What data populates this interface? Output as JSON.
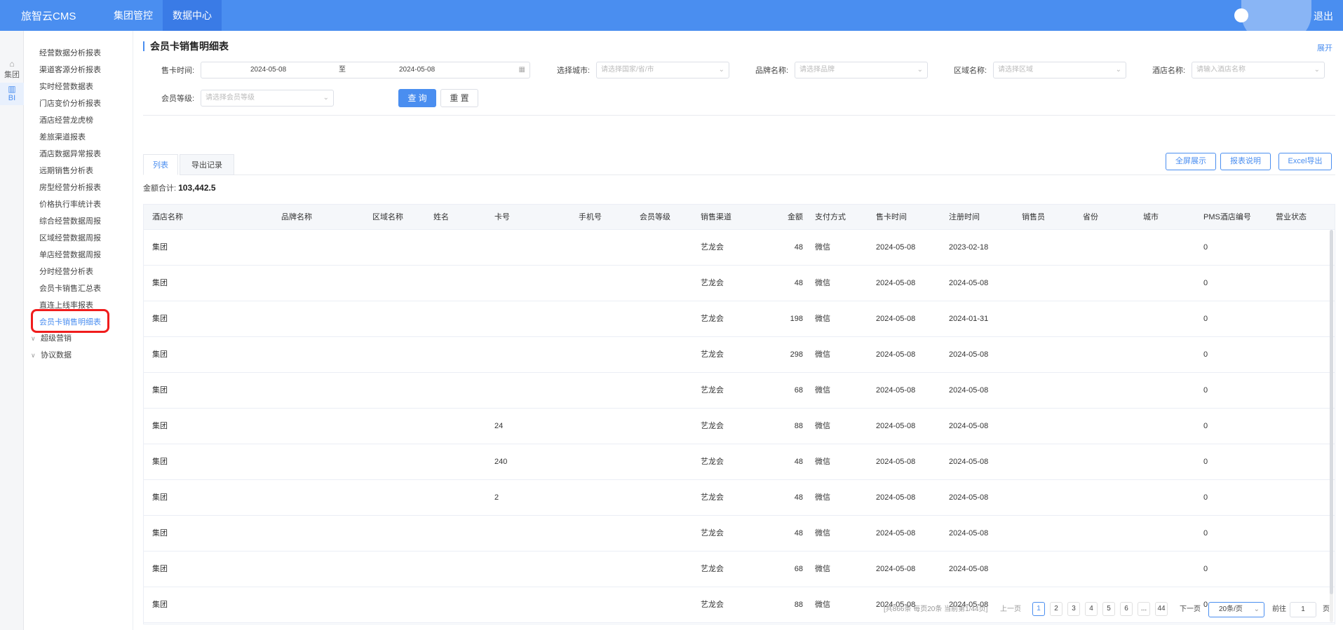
{
  "topbar": {
    "brand": "旅智云CMS",
    "nav": [
      "集团管控",
      "数据中心"
    ],
    "logout": "退出"
  },
  "rail": [
    {
      "icon": "building-icon",
      "label": "集团"
    },
    {
      "icon": "bar-chart-icon",
      "label": "BI"
    }
  ],
  "sidebar": {
    "items": [
      "经营数据分析报表",
      "渠道客源分析报表",
      "实时经营数据表",
      "门店变价分析报表",
      "酒店经营龙虎榜",
      "差旅渠道报表",
      "酒店数据异常报表",
      "远期销售分析表",
      "房型经营分析报表",
      "价格执行率统计表",
      "综合经营数据周报",
      "区域经营数据周报",
      "单店经营数据周报",
      "分时经营分析表",
      "会员卡销售汇总表",
      "直连上线率报表",
      "会员卡销售明细表"
    ],
    "active_index": 16,
    "groups": [
      "超级营销",
      "协议数据"
    ]
  },
  "page": {
    "title": "会员卡销售明细表",
    "expand": "展开"
  },
  "filters": {
    "sale_time_label": "售卡时间:",
    "date_from": "2024-05-08",
    "date_to_sep": "至",
    "date_to": "2024-05-08",
    "city_label": "选择城市:",
    "city_placeholder": "请选择国家/省/市",
    "brand_label": "品牌名称:",
    "brand_placeholder": "请选择品牌",
    "region_label": "区域名称:",
    "region_placeholder": "请选择区域",
    "hotel_label": "酒店名称:",
    "hotel_placeholder": "请输入酒店名称",
    "level_label": "会员等级:",
    "level_placeholder": "请选择会员等级",
    "query": "查 询",
    "reset": "重 置"
  },
  "tabs": [
    "列表",
    "导出记录"
  ],
  "actions": [
    "全屏展示",
    "报表说明",
    "Excel导出"
  ],
  "summary": {
    "label": "金额合计:",
    "value": "103,442.5"
  },
  "table": {
    "headers": [
      "酒店名称",
      "品牌名称",
      "区域名称",
      "姓名",
      "卡号",
      "手机号",
      "会员等级",
      "销售渠道",
      "金额",
      "支付方式",
      "售卡时间",
      "注册时间",
      "销售员",
      "省份",
      "城市",
      "PMS酒店编号",
      "营业状态"
    ],
    "rows": [
      [
        "集团",
        "",
        "",
        "",
        "",
        "",
        "",
        "艺龙会",
        "48",
        "微信",
        "2024-05-08",
        "2023-02-18",
        "",
        "",
        "",
        "0",
        ""
      ],
      [
        "集团",
        "",
        "",
        "",
        "",
        "",
        "",
        "艺龙会",
        "48",
        "微信",
        "2024-05-08",
        "2024-05-08",
        "",
        "",
        "",
        "0",
        ""
      ],
      [
        "集团",
        "",
        "",
        "",
        "",
        "",
        "",
        "艺龙会",
        "198",
        "微信",
        "2024-05-08",
        "2024-01-31",
        "",
        "",
        "",
        "0",
        ""
      ],
      [
        "集团",
        "",
        "",
        "",
        "",
        "",
        "",
        "艺龙会",
        "298",
        "微信",
        "2024-05-08",
        "2024-05-08",
        "",
        "",
        "",
        "0",
        ""
      ],
      [
        "集团",
        "",
        "",
        "",
        "",
        "",
        "",
        "艺龙会",
        "68",
        "微信",
        "2024-05-08",
        "2024-05-08",
        "",
        "",
        "",
        "0",
        ""
      ],
      [
        "集团",
        "",
        "",
        "",
        "24",
        "",
        "",
        "艺龙会",
        "88",
        "微信",
        "2024-05-08",
        "2024-05-08",
        "",
        "",
        "",
        "0",
        ""
      ],
      [
        "集团",
        "",
        "",
        "",
        "240",
        "",
        "",
        "艺龙会",
        "48",
        "微信",
        "2024-05-08",
        "2024-05-08",
        "",
        "",
        "",
        "0",
        ""
      ],
      [
        "集团",
        "",
        "",
        "",
        "2",
        "",
        "",
        "艺龙会",
        "48",
        "微信",
        "2024-05-08",
        "2024-05-08",
        "",
        "",
        "",
        "0",
        ""
      ],
      [
        "集团",
        "",
        "",
        "",
        "",
        "",
        "",
        "艺龙会",
        "48",
        "微信",
        "2024-05-08",
        "2024-05-08",
        "",
        "",
        "",
        "0",
        ""
      ],
      [
        "集团",
        "",
        "",
        "",
        "",
        "",
        "",
        "艺龙会",
        "68",
        "微信",
        "2024-05-08",
        "2024-05-08",
        "",
        "",
        "",
        "0",
        ""
      ],
      [
        "集团",
        "",
        "",
        "",
        "",
        "",
        "",
        "艺龙会",
        "88",
        "微信",
        "2024-05-08",
        "2024-05-08",
        "",
        "",
        "",
        "0",
        ""
      ]
    ]
  },
  "pagination": {
    "info": "[共866条 每页20条 当前第1/44页]",
    "prev": "上一页",
    "pages": [
      "1",
      "2",
      "3",
      "4",
      "5",
      "6",
      "...",
      "44"
    ],
    "next": "下一页",
    "page_size": "20条/页",
    "goto_label": "前往",
    "goto_value": "1",
    "page_suffix": "页"
  },
  "colors": {
    "topbar": "#4a8ef0",
    "accent": "#4a8ef0",
    "highlight": "#f01c1c"
  }
}
